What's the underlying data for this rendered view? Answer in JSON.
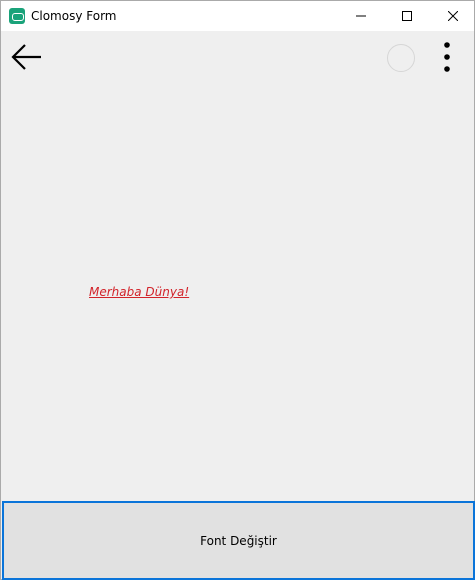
{
  "window": {
    "title": "Clomosy Form",
    "icon": "clomosy-app-icon",
    "controls": [
      "minimize-icon",
      "maximize-icon",
      "close-icon"
    ]
  },
  "toolbar": {
    "back_icon": "arrow-left-icon",
    "status_icon": "loading-circle-icon",
    "menu_icon": "more-vertical-icon"
  },
  "content": {
    "label_text": "Merhaba Dünya!",
    "label_color": "#d2232a"
  },
  "footer": {
    "button_label": "Font Değiştir",
    "button_border_color": "#0a74d9"
  }
}
